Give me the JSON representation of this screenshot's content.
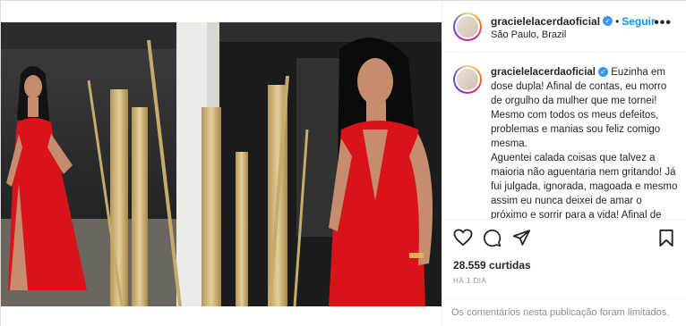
{
  "post_header": {
    "username": "gracielelacerdaoficial",
    "follow_label": "Seguir",
    "separator": "•",
    "location": "São Paulo, Brazil",
    "more_label": "•••"
  },
  "caption": {
    "username": "gracielelacerdaoficial",
    "text_lines": [
      "Euzinha em dose dupla! Afinal de contas, eu morro de orgulho da mulher que me tornei! Mesmo com todos os meus defeitos, problemas e manias sou feliz comigo mesma.",
      "Aguentei calada coisas que talvez a maioria não aguentaria nem gritando! Já fui julgada, ignorada, magoada e mesmo assim eu nunca deixei de amar o próximo e sorrir para a vida! Afinal de"
    ]
  },
  "actions": {
    "likes": "28.559 curtidas",
    "time": "HÁ 1 DIA"
  },
  "comments_limited": "Os comentários nesta publicação foram limitados.",
  "icons": [
    "heart-icon",
    "comment-icon",
    "share-icon",
    "bookmark-icon",
    "verified-badge-icon",
    "more-options-icon"
  ],
  "colors": {
    "accent": "#0095f6",
    "verified": "#3897f0",
    "dress": "#d8141a",
    "text": "#262626",
    "muted": "#8e8e8e"
  }
}
